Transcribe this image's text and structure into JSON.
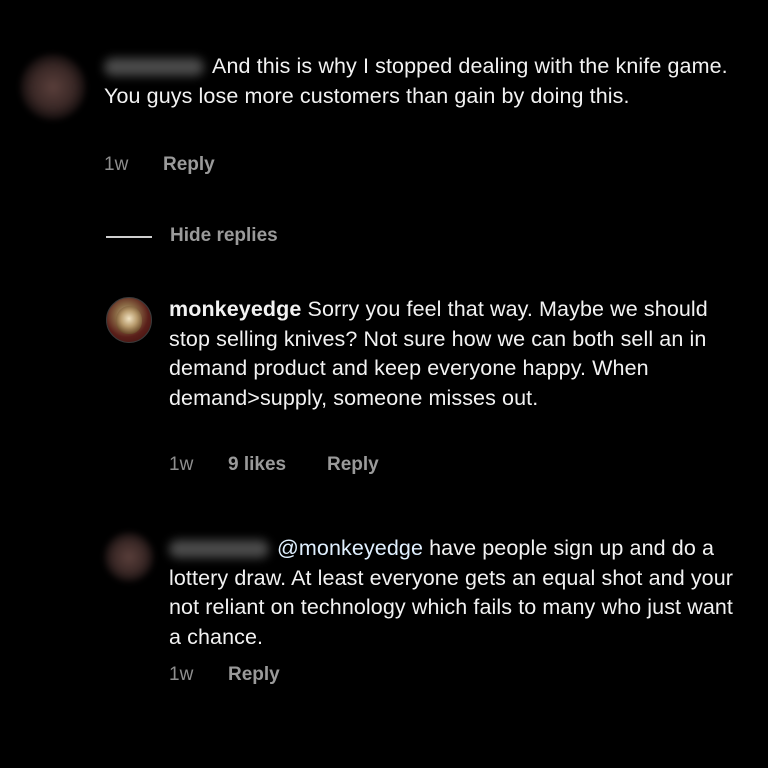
{
  "comments": [
    {
      "text": "And this is why I stopped dealing with the knife game. You guys lose more customers than gain by doing this.",
      "time": "1w",
      "reply_label": "Reply"
    }
  ],
  "hide_replies_label": "Hide replies",
  "replies": [
    {
      "username": "monkeyedge",
      "text": "Sorry you feel that way. Maybe we should stop selling knives? Not sure how we can both sell an in demand product and keep everyone happy. When demand>supply, someone misses out.",
      "time": "1w",
      "likes": "9 likes",
      "reply_label": "Reply"
    },
    {
      "mention": "@monkeyedge",
      "text": "have people sign up and do a lottery draw. At least everyone gets an equal shot and your not reliant on technology which fails to many who just want a chance.",
      "time": "1w",
      "reply_label": "Reply"
    }
  ]
}
